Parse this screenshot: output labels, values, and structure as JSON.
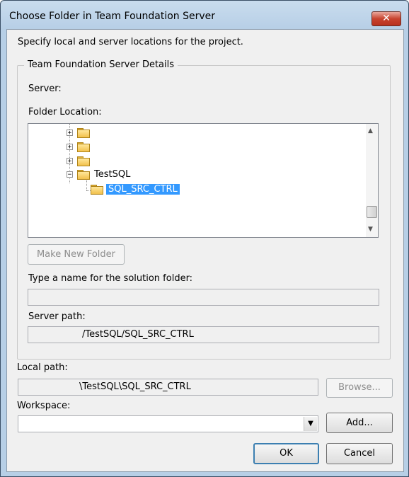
{
  "window": {
    "title": "Choose Folder in Team Foundation Server",
    "close_label": "✕"
  },
  "instructions": "Specify local and server locations for the project.",
  "group": {
    "legend": "Team Foundation Server Details"
  },
  "server": {
    "label": "Server:"
  },
  "folder_location": {
    "label": "Folder Location:",
    "nodes": [
      {
        "expander": "+",
        "label": ""
      },
      {
        "expander": "+",
        "label": ""
      },
      {
        "expander": "+",
        "label": ""
      },
      {
        "expander": "−",
        "label": "TestSQL"
      },
      {
        "expander": "",
        "label": "SQL_SRC_CTRL",
        "selected": true
      }
    ],
    "scroll_up": "▲",
    "scroll_down": "▼"
  },
  "make_new_folder": "Make New Folder",
  "solution_folder": {
    "label": "Type a name for the solution folder:",
    "value": ""
  },
  "server_path": {
    "label": "Server path:",
    "value": "/TestSQL/SQL_SRC_CTRL"
  },
  "local_path": {
    "label": "Local path:",
    "value": "\\TestSQL\\SQL_SRC_CTRL"
  },
  "browse": "Browse...",
  "workspace": {
    "label": "Workspace:",
    "value": "",
    "dropdown": "▼"
  },
  "add": "Add...",
  "ok": "OK",
  "cancel": "Cancel"
}
